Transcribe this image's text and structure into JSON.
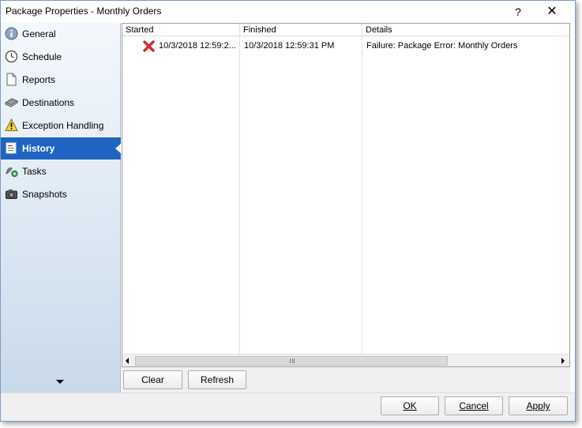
{
  "window": {
    "title": "Package Properties - Monthly Orders",
    "help_label": "?",
    "close_label": "✕"
  },
  "sidebar": {
    "items": [
      {
        "label": "General",
        "icon": "info-icon"
      },
      {
        "label": "Schedule",
        "icon": "clock-icon"
      },
      {
        "label": "Reports",
        "icon": "document-icon"
      },
      {
        "label": "Destinations",
        "icon": "destination-icon"
      },
      {
        "label": "Exception Handling",
        "icon": "warning-icon"
      },
      {
        "label": "History",
        "icon": "history-icon",
        "active": true
      },
      {
        "label": "Tasks",
        "icon": "tasks-icon"
      },
      {
        "label": "Snapshots",
        "icon": "camera-icon"
      }
    ]
  },
  "history": {
    "columns": [
      "Started",
      "Finished",
      "Details"
    ],
    "rows": [
      {
        "status_icon": "failure-x-icon",
        "started": "10/3/2018 12:59:2...",
        "finished": "10/3/2018 12:59:31 PM",
        "details": "Failure: Package Error: Monthly Orders"
      }
    ]
  },
  "list_buttons": {
    "clear": "Clear",
    "refresh": "Refresh"
  },
  "footer": {
    "ok": "OK",
    "cancel": "Cancel",
    "apply": "Apply"
  },
  "colors": {
    "active_item": "#1f64c0",
    "failure": "#d22b2b"
  }
}
